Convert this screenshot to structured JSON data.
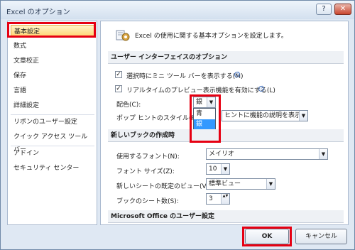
{
  "window": {
    "title": "Excel のオプション",
    "help_label": "?",
    "close_label": "✕"
  },
  "sidebar": {
    "items": [
      {
        "label": "基本設定"
      },
      {
        "label": "数式"
      },
      {
        "label": "文章校正"
      },
      {
        "label": "保存"
      },
      {
        "label": "言語"
      },
      {
        "label": "詳細設定"
      },
      {
        "label": "リボンのユーザー設定"
      },
      {
        "label": "クイック アクセス ツール バー"
      },
      {
        "label": "アドイン"
      },
      {
        "label": "セキュリティ センター"
      }
    ]
  },
  "main": {
    "intro": "Excel の使用に関する基本オプションを設定します。",
    "ui_section": {
      "title": "ユーザー インターフェイスのオプション",
      "mini_toolbar_label": "選択時にミニ ツール バーを表示する(M)",
      "live_preview_label": "リアルタイムのプレビュー表示機能を有効にする(L)",
      "color_label": "配色(C):",
      "color_value": "銀",
      "color_options": [
        "青",
        "銀",
        "黒"
      ],
      "tooltip_label": "ポップ ヒントのスタイル(R):",
      "tooltip_value": "ヒントに機能の説明を表示する"
    },
    "workbook_section": {
      "title": "新しいブックの作成時",
      "font_label": "使用するフォント(N):",
      "font_value": "メイリオ",
      "size_label": "フォント サイズ(Z):",
      "size_value": "10",
      "view_label": "新しいシートの既定のビュー(V):",
      "view_value": "標準ビュー",
      "sheets_label": "ブックのシート数(S):",
      "sheets_value": "3"
    },
    "office_section": {
      "title": "Microsoft Office のユーザー設定"
    }
  },
  "footer": {
    "ok_label": "OK",
    "cancel_label": "キャンセル"
  },
  "icons": {
    "info": "ⓘ",
    "checkmark": "✓",
    "dropdown": "▼",
    "spinner": "▲▼"
  },
  "colors": {
    "highlight": "#e60012",
    "selected_bg": "#ffd36e",
    "active_option": "#3399ff"
  }
}
